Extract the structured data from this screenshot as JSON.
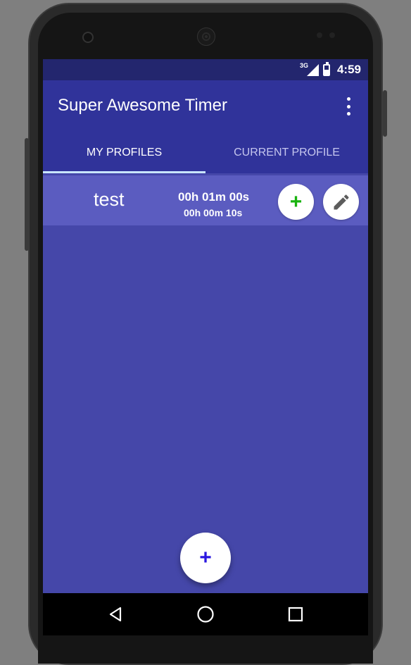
{
  "status_bar": {
    "network": "3G",
    "time": "4:59",
    "icons": [
      "signal-icon",
      "battery-charging-icon"
    ]
  },
  "app_bar": {
    "title": "Super Awesome Timer",
    "overflow_icon": "more-vert-icon"
  },
  "tabs": [
    {
      "label": "MY PROFILES",
      "selected": true
    },
    {
      "label": "CURRENT PROFILE",
      "selected": false
    }
  ],
  "profiles": [
    {
      "name": "test",
      "total_time": "00h 01m 00s",
      "interval_time": "00h 00m 10s",
      "actions": [
        "add-icon",
        "edit-pencil-icon"
      ]
    }
  ],
  "fab": {
    "icon": "add-icon"
  },
  "nav": {
    "buttons": [
      "back-icon",
      "home-icon",
      "recents-icon"
    ]
  },
  "colors": {
    "status_bar": "#23266e",
    "app_bar": "#30339a",
    "background": "#4547a9",
    "profile_row": "#5b5cc0",
    "tab_indicator": "#c9e6ff",
    "add_green": "#19b30f",
    "fab_plus": "#2a17e0"
  }
}
